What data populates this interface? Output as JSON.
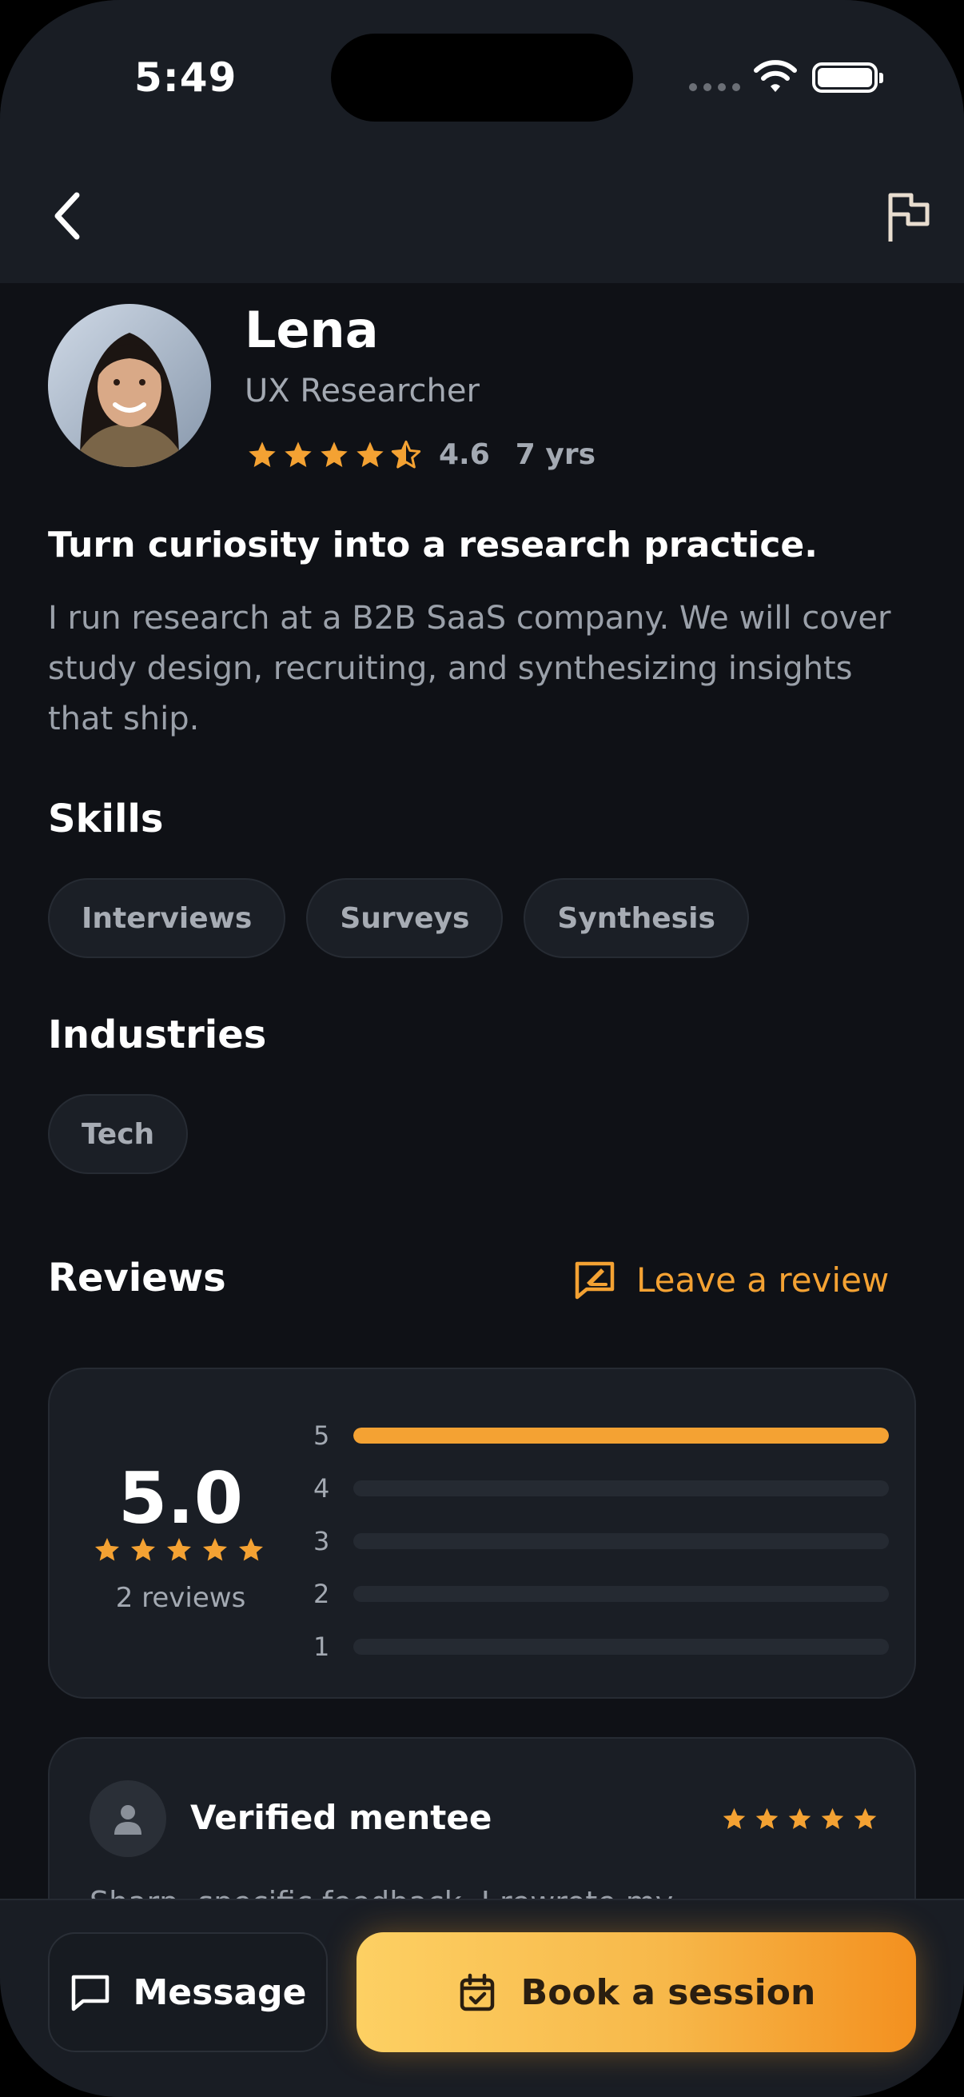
{
  "status_bar": {
    "time": "5:49"
  },
  "nav": {
    "back_icon": "chevron-left-icon",
    "report_icon": "flag-icon"
  },
  "profile": {
    "name": "Lena",
    "role": "UX Researcher",
    "rating": "4.6",
    "stars_value": 4.5,
    "experience": "7 yrs",
    "headline": "Turn curiosity into a research practice.",
    "bio": "I run research at a B2B SaaS company. We will cover study design, recruiting, and synthesizing insights that ship."
  },
  "skills": {
    "title": "Skills",
    "items": [
      "Interviews",
      "Surveys",
      "Synthesis"
    ]
  },
  "industries": {
    "title": "Industries",
    "items": [
      "Tech"
    ]
  },
  "reviews": {
    "title": "Reviews",
    "leave_review_label": "Leave a review",
    "average": "5.0",
    "count_label": "2 reviews",
    "distribution": [
      {
        "label": "5",
        "fraction": 1.0
      },
      {
        "label": "4",
        "fraction": 0
      },
      {
        "label": "3",
        "fraction": 0
      },
      {
        "label": "2",
        "fraction": 0
      },
      {
        "label": "1",
        "fraction": 0
      }
    ],
    "items": [
      {
        "reviewer": "Verified mentee",
        "stars": 5,
        "text": "Sharp, specific feedback. I rewrote my"
      }
    ]
  },
  "bottom": {
    "message_label": "Message",
    "book_label": "Book a session"
  },
  "colors": {
    "accent": "#f4a233",
    "background": "#0f1116",
    "card": "#1a1e25"
  }
}
